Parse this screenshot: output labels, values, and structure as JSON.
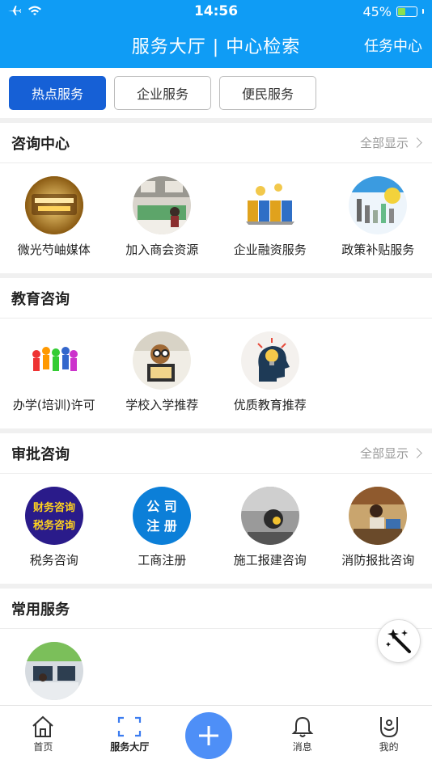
{
  "status": {
    "time": "14:56",
    "battery": "45%",
    "battery_level": 0.45
  },
  "header": {
    "title": "服务大厅 | 中心检索",
    "right_link": "任务中心"
  },
  "segments": [
    {
      "label": "热点服务",
      "active": true
    },
    {
      "label": "企业服务",
      "active": false
    },
    {
      "label": "便民服务",
      "active": false
    }
  ],
  "sections": [
    {
      "title": "咨询中心",
      "more": "全部显示",
      "items": [
        {
          "label": "微光芍岫媒体",
          "icon": "media-franchise-thumb"
        },
        {
          "label": "加入商会资源",
          "icon": "chamber-office-thumb"
        },
        {
          "label": "企业融资服务",
          "icon": "bank-thumb"
        },
        {
          "label": "政策补贴服务",
          "icon": "subsidy-thumb"
        }
      ]
    },
    {
      "title": "教育咨询",
      "more": "",
      "items": [
        {
          "label": "办学(培训)许可",
          "icon": "people-team-thumb"
        },
        {
          "label": "学校入学推荐",
          "icon": "reading-student-thumb"
        },
        {
          "label": "优质教育推荐",
          "icon": "idea-head-thumb"
        }
      ]
    },
    {
      "title": "审批咨询",
      "more": "全部显示",
      "items": [
        {
          "label": "税务咨询",
          "icon": "tax-consult-thumb",
          "thumb_text": [
            "财务咨询",
            "税务咨询"
          ]
        },
        {
          "label": "工商注册",
          "icon": "company-register-thumb",
          "thumb_text": [
            "公 司",
            "注 册"
          ]
        },
        {
          "label": "施工报建咨询",
          "icon": "construction-thumb"
        },
        {
          "label": "消防报批咨询",
          "icon": "fire-approval-thumb"
        }
      ]
    },
    {
      "title": "常用服务",
      "more": "",
      "items": [
        {
          "label": "",
          "icon": "office-thumb"
        }
      ]
    }
  ],
  "tabbar": [
    {
      "label": "首页",
      "icon": "home-icon"
    },
    {
      "label": "服务大厅",
      "icon": "scan-frame-icon",
      "active": true
    },
    {
      "label": "",
      "icon": "plus-icon"
    },
    {
      "label": "消息",
      "icon": "bell-icon"
    },
    {
      "label": "我的",
      "icon": "profile-icon"
    }
  ],
  "colors": {
    "primary": "#0f9cf5",
    "segment_active": "#1660d6",
    "plus": "#4e8ff7"
  }
}
